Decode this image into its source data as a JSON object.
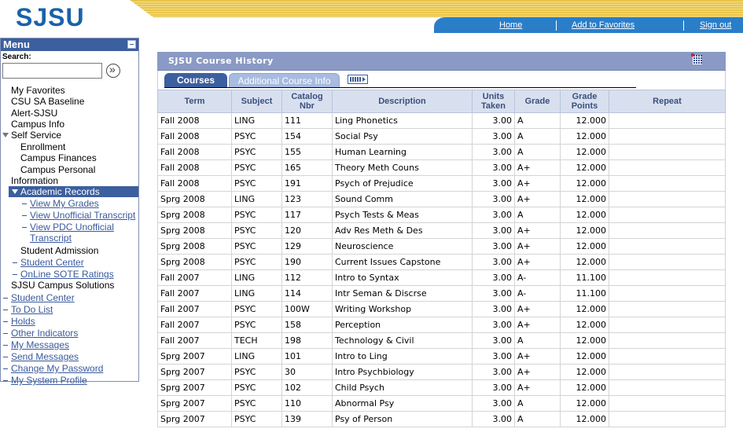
{
  "header": {
    "logo": "SJSU",
    "nav": {
      "home": "Home",
      "favorites": "Add to Favorites",
      "signout": "Sign out"
    }
  },
  "sidebar": {
    "title": "Menu",
    "search_label": "Search:",
    "search_value": "",
    "items": [
      {
        "label": "My Favorites",
        "state": "collapsed",
        "level": 0
      },
      {
        "label": "CSU SA Baseline",
        "state": "collapsed",
        "level": 0
      },
      {
        "label": "Alert-SJSU",
        "state": "collapsed",
        "level": 0
      },
      {
        "label": "Campus Info",
        "state": "collapsed",
        "level": 0
      },
      {
        "label": "Self Service",
        "state": "expanded",
        "level": 0
      },
      {
        "label": "Enrollment",
        "state": "collapsed",
        "level": 1
      },
      {
        "label": "Campus Finances",
        "state": "collapsed",
        "level": 1
      },
      {
        "label": "Campus Personal Information",
        "state": "collapsed",
        "level": 1
      },
      {
        "label": "Academic Records",
        "state": "expanded",
        "level": 1,
        "selected": true
      },
      {
        "label": "View My Grades",
        "state": "link",
        "level": 2
      },
      {
        "label": "View Unofficial Transcript",
        "state": "link",
        "level": 2
      },
      {
        "label": "View PDC Unofficial Transcript",
        "state": "link",
        "level": 2
      },
      {
        "label": "Student Admission",
        "state": "collapsed",
        "level": 1
      },
      {
        "label": "Student Center",
        "state": "link",
        "level": 1
      },
      {
        "label": "OnLine SOTE Ratings",
        "state": "link",
        "level": 1
      },
      {
        "label": "SJSU Campus Solutions",
        "state": "collapsed",
        "level": 0
      },
      {
        "label": "Student Center",
        "state": "link",
        "level": 0
      },
      {
        "label": "To Do List",
        "state": "link",
        "level": 0
      },
      {
        "label": "Holds",
        "state": "link",
        "level": 0
      },
      {
        "label": "Other Indicators",
        "state": "link",
        "level": 0
      },
      {
        "label": "My Messages",
        "state": "link",
        "level": 0
      },
      {
        "label": "Send Messages",
        "state": "link",
        "level": 0
      },
      {
        "label": "Change My Password",
        "state": "link",
        "level": 0
      },
      {
        "label": "My System Profile",
        "state": "link",
        "level": 0
      }
    ]
  },
  "main": {
    "title": "SJSU Course History",
    "tabs": [
      {
        "label": "Courses",
        "active": true
      },
      {
        "label": "Additional Course Info",
        "active": false
      }
    ],
    "columns": [
      "Term",
      "Subject",
      "Catalog Nbr",
      "Description",
      "Units Taken",
      "Grade",
      "Grade Points",
      "Repeat"
    ],
    "rows": [
      [
        "Fall 2008",
        "LING",
        "111",
        "Ling Phonetics",
        "3.00",
        "A",
        "12.000",
        ""
      ],
      [
        "Fall 2008",
        "PSYC",
        "154",
        "Social Psy",
        "3.00",
        "A",
        "12.000",
        ""
      ],
      [
        "Fall 2008",
        "PSYC",
        "155",
        "Human Learning",
        "3.00",
        "A",
        "12.000",
        ""
      ],
      [
        "Fall 2008",
        "PSYC",
        "165",
        "Theory Meth Couns",
        "3.00",
        "A+",
        "12.000",
        ""
      ],
      [
        "Fall 2008",
        "PSYC",
        "191",
        "Psych of Prejudice",
        "3.00",
        "A+",
        "12.000",
        ""
      ],
      [
        "Sprg 2008",
        "LING",
        "123",
        "Sound Comm",
        "3.00",
        "A+",
        "12.000",
        ""
      ],
      [
        "Sprg 2008",
        "PSYC",
        "117",
        "Psych Tests & Meas",
        "3.00",
        "A",
        "12.000",
        ""
      ],
      [
        "Sprg 2008",
        "PSYC",
        "120",
        "Adv Res Meth & Des",
        "3.00",
        "A+",
        "12.000",
        ""
      ],
      [
        "Sprg 2008",
        "PSYC",
        "129",
        "Neuroscience",
        "3.00",
        "A+",
        "12.000",
        ""
      ],
      [
        "Sprg 2008",
        "PSYC",
        "190",
        "Current Issues Capstone",
        "3.00",
        "A+",
        "12.000",
        ""
      ],
      [
        "Fall 2007",
        "LING",
        "112",
        "Intro to Syntax",
        "3.00",
        "A-",
        "11.100",
        ""
      ],
      [
        "Fall 2007",
        "LING",
        "114",
        "Intr Seman & Discrse",
        "3.00",
        "A-",
        "11.100",
        ""
      ],
      [
        "Fall 2007",
        "PSYC",
        "100W",
        "Writing Workshop",
        "3.00",
        "A+",
        "12.000",
        ""
      ],
      [
        "Fall 2007",
        "PSYC",
        "158",
        "Perception",
        "3.00",
        "A+",
        "12.000",
        ""
      ],
      [
        "Fall 2007",
        "TECH",
        "198",
        "Technology & Civil",
        "3.00",
        "A",
        "12.000",
        ""
      ],
      [
        "Sprg 2007",
        "LING",
        "101",
        "Intro to Ling",
        "3.00",
        "A+",
        "12.000",
        ""
      ],
      [
        "Sprg 2007",
        "PSYC",
        "30",
        "Intro Psychbiology",
        "3.00",
        "A+",
        "12.000",
        ""
      ],
      [
        "Sprg 2007",
        "PSYC",
        "102",
        "Child Psych",
        "3.00",
        "A+",
        "12.000",
        ""
      ],
      [
        "Sprg 2007",
        "PSYC",
        "110",
        "Abnormal Psy",
        "3.00",
        "A",
        "12.000",
        ""
      ],
      [
        "Sprg 2007",
        "PSYC",
        "139",
        "Psy of Person",
        "3.00",
        "A",
        "12.000",
        ""
      ]
    ]
  }
}
